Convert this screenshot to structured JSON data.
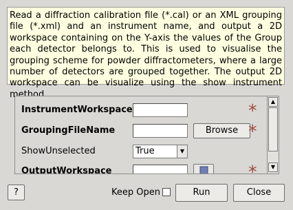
{
  "description": "Read a diffraction calibration file (*.cal) or an XML grouping file (*.xml) and an instrument name, and output a 2D workspace containing on the Y-axis the values of the Group each detector belongs to. This is used to visualise the grouping scheme for powder diffractometers, where a large number of detectors are grouped together. The output 2D workspace can be visualize using the show instrument method.",
  "properties": {
    "instrument_workspace": {
      "label": "InstrumentWorkspace",
      "value": "",
      "required_mark": "*"
    },
    "grouping_file_name": {
      "label": "GroupingFileName",
      "value": "",
      "browse_label": "Browse",
      "required_mark": "*"
    },
    "show_unselected": {
      "label": "ShowUnselected",
      "selected": "True"
    },
    "output_workspace": {
      "label": "OutputWorkspace",
      "value": "",
      "required_mark": "*"
    }
  },
  "footer": {
    "help_label": "?",
    "keep_open_label": "Keep Open",
    "keep_open_checked": false,
    "run_label": "Run",
    "close_label": "Close"
  },
  "colors": {
    "required_star": "#a2483a",
    "description_bg": "#fffee0"
  }
}
